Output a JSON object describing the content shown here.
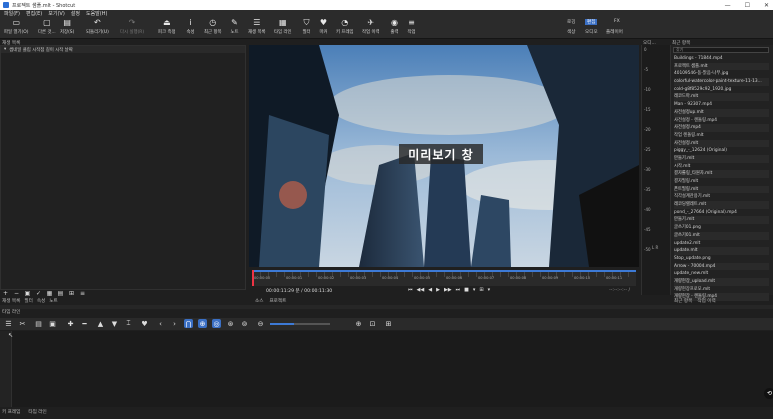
{
  "window": {
    "title": "프로젝트 샘플.mlt - Shotcut",
    "controls": [
      "—",
      "☐",
      "✕"
    ]
  },
  "menu": [
    "파일(F)",
    "편집(E)",
    "보기(V)",
    "설정",
    "도움말(H)"
  ],
  "toolbar": {
    "buttons": [
      {
        "icon": "▭",
        "label": "파일 열기(O)"
      },
      {
        "icon": "▢",
        "label": "다른 것..."
      },
      {
        "icon": "▤",
        "label": "저장(S)"
      },
      {
        "icon": "↶",
        "label": "되돌리기(U)"
      },
      {
        "icon": "↷",
        "label": "다시 실행(R)"
      },
      {
        "icon": "⏏",
        "label": "피크 측정"
      },
      {
        "icon": "i",
        "label": "속성"
      },
      {
        "icon": "◷",
        "label": "최근 항목"
      },
      {
        "icon": "✎",
        "label": "노트"
      },
      {
        "icon": "☰",
        "label": "재생 목록"
      },
      {
        "icon": "▦",
        "label": "타임 라인"
      },
      {
        "icon": "⛉",
        "label": "필터"
      },
      {
        "icon": "♥",
        "label": "마커"
      },
      {
        "icon": "◔",
        "label": "키 프레임"
      },
      {
        "icon": "✈",
        "label": "작업 이력"
      },
      {
        "icon": "◉",
        "label": "출력"
      },
      {
        "icon": "≡",
        "label": "작업"
      }
    ],
    "layouts_top": [
      "로깅",
      "편집",
      "FX"
    ],
    "layouts_bottom": [
      "색상",
      "오디오",
      "플레이어"
    ],
    "active_layout": "편집"
  },
  "playlist": {
    "title": "재생 목록",
    "header_text": "썸네일 클립 시작점 길이 시작 날짜",
    "tabs": [
      "재생 목록",
      "필터",
      "속성",
      "노트"
    ]
  },
  "preview": {
    "label": "미리보기 창"
  },
  "ruler": {
    "labels": [
      "00:00:00",
      "00:00:01",
      "00:00:02",
      "00:00:03",
      "00:00:04",
      "00:00:05",
      "00:00:06",
      "00:00:07",
      "00:00:08",
      "00:00:09",
      "00:00:10",
      "00:00:11"
    ],
    "progress": 1.0
  },
  "transport": {
    "timecode": "00:00:11:29 분 / 00:00:11:30",
    "timecode_right": "--:--:--:-- /",
    "controls": [
      "⏮",
      "◀◀",
      "◀",
      "▶",
      "▶▶",
      "⏭",
      "■",
      "▾",
      "⊞",
      "▾"
    ]
  },
  "source_tabs": [
    "소스",
    "프로젝트"
  ],
  "meters": {
    "title": "오디...",
    "scale": [
      "0",
      "-5",
      "-10",
      "-15",
      "-20",
      "-25",
      "-30",
      "-35",
      "-40",
      "-45",
      "-50"
    ],
    "lr": "L R"
  },
  "recent": {
    "title": "최근 항목",
    "search_placeholder": "찾기",
    "items": [
      "Buildings - 71844.mp4",
      "프로젝트 샘플.mlt",
      "40109546-동-맑음-나무.jpg",
      "colorful-watercolor-paint-texture-11-13...",
      "cold-g8f8529c92_1920.jpg",
      "레코드마.mlt",
      "Man - 92307.mp4",
      "사전설정up.mlt",
      "사전설정 - 렌돌링.mp4",
      "사전설정.mp4",
      "작업 렌돌링.mlt",
      "사전설정.mlt",
      "piggy_-_12624 (Original)",
      "만들기.mlt",
      "시작.mlt",
      "결자롤링_타원자.mlt",
      "결자필링.mlt",
      "폰트필링.mlt",
      "직각설계관용기.mlt",
      "레코딩렐레트.mlt",
      "pond_-_27664 (Original).mp4",
      "만들기.mlt",
      "글쓰기01.png",
      "글쓰기01.mlt",
      "update2.mlt",
      "update.mlt",
      "Stop_update.png",
      "Arrow - 70004.mp4",
      "update_new.mlt",
      "개량현장_upload.mlt",
      "개량현장프로모.mlt",
      "개량현장 - 렌돌링.mp4"
    ],
    "tabs": [
      "최근 항목",
      "작업 이력"
    ]
  },
  "timeline": {
    "title": "타임 라인",
    "tools": [
      "☰",
      "✂",
      "▤",
      "▣",
      "✚",
      "━",
      "▲",
      "▼",
      "⌶",
      "♥",
      "‹",
      "›",
      "⋂",
      "⊕",
      "◎",
      "⊛",
      "⊚",
      "⊖",
      "⊕",
      "⊡",
      "⊞"
    ],
    "zoom": 0.4
  },
  "bottom_tabs": [
    "키 프레임",
    "타임 라인"
  ],
  "colors": {
    "accent": "#3a6fc4",
    "background": "#1f1f1f",
    "panel": "#2b2b2b"
  }
}
